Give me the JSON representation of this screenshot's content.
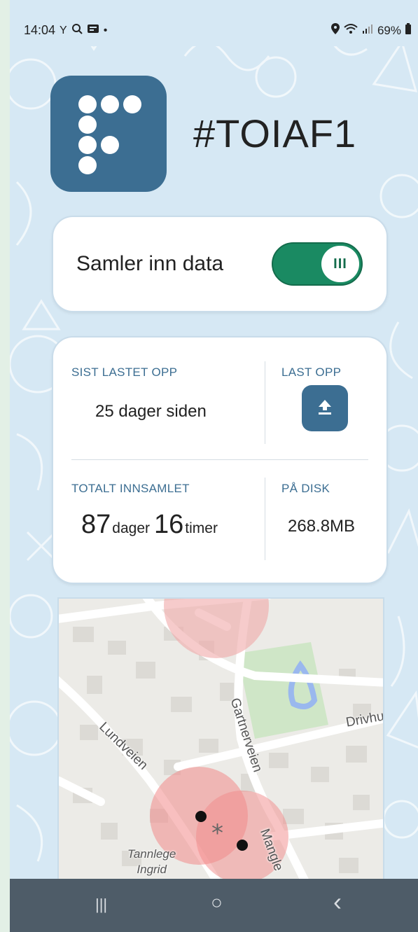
{
  "status_bar": {
    "time": "14:04",
    "battery": "69%",
    "icons_left": [
      "antenna-icon",
      "search-icon",
      "sim-icon",
      "dot-icon"
    ],
    "icons_right": [
      "location-icon",
      "wifi-icon",
      "signal-icon",
      "battery-icon"
    ]
  },
  "header": {
    "app_id": "#TOIAF1",
    "logo": "app-logo-icon"
  },
  "collect": {
    "label": "Samler inn data",
    "toggle_on": true,
    "knob_glyph": "III",
    "accent": "#1a8a62"
  },
  "stats": {
    "last_upload_label": "SIST LASTET OPP",
    "last_upload_value": "25 dager siden",
    "upload_label": "LAST OPP",
    "upload_icon": "upload-icon",
    "total_label": "TOTALT INNSAMLET",
    "total_days": "87",
    "days_unit": "dager",
    "total_hours": "16",
    "hours_unit": "timer",
    "disk_label": "PÅ DISK",
    "disk_value": "268.8MB",
    "label_color": "#3c6e92"
  },
  "map": {
    "streets": [
      "Lundveien",
      "Gartnerveien",
      "Drivhu",
      "Mangle"
    ],
    "poi_line1": "Tannlege",
    "poi_line2": "Ingrid",
    "marker_glyph": "*"
  },
  "nav_bar": {
    "recent": "|||",
    "home": "○",
    "back": "‹"
  }
}
